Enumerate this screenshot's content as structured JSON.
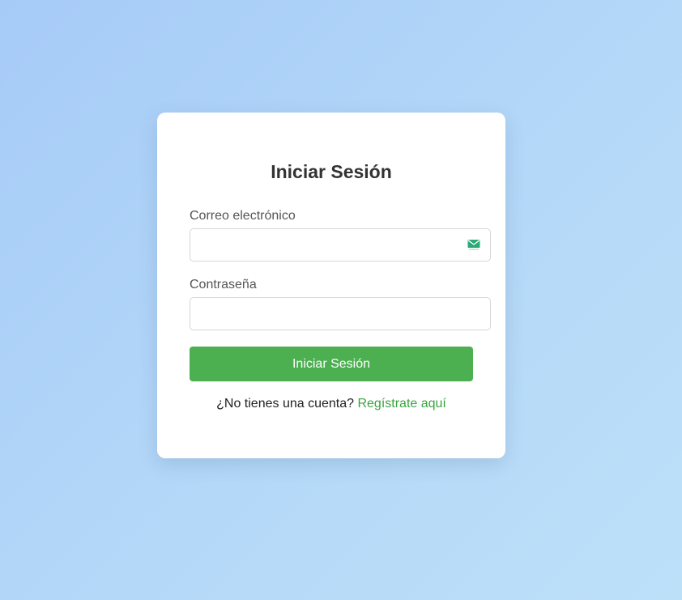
{
  "login": {
    "title": "Iniciar Sesión",
    "email_label": "Correo electrónico",
    "email_value": "",
    "email_icon": "mail-icon",
    "password_label": "Contraseña",
    "password_value": "",
    "submit_label": "Iniciar Sesión",
    "register_prompt": "¿No tienes una cuenta?",
    "register_link": "Regístrate aquí"
  },
  "colors": {
    "accent": "#4caf50",
    "link": "#3aa33e",
    "background_start": "#a6cbf7",
    "background_end": "#bde0f9"
  }
}
